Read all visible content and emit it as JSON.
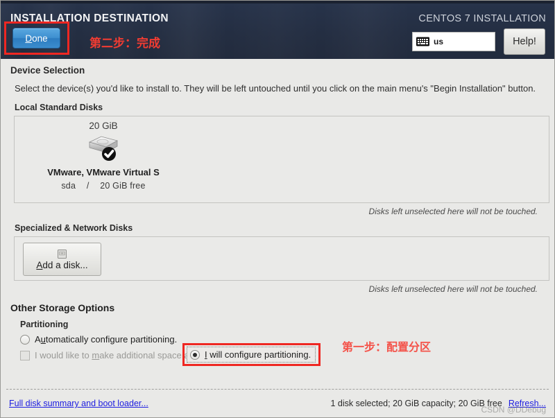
{
  "header": {
    "title": "INSTALLATION DESTINATION",
    "product_title": "CENTOS 7 INSTALLATION",
    "done_label_prefix": "",
    "done_mnemonic": "D",
    "done_label_rest": "one",
    "keyboard_layout": "us",
    "keyboard_icon": "keyboard-icon",
    "help_label": "Help!",
    "annotation": "第二步：完成",
    "accent_blue": "#3e8fd0",
    "annotation_red": "#f23c32",
    "background": "#242e42"
  },
  "device_selection": {
    "title": "Device Selection",
    "description": "Select the device(s) you'd like to install to.  They will be left untouched until you click on the main menu's \"Begin Installation\" button.",
    "local_disks_title": "Local Standard Disks",
    "local_disks": [
      {
        "size": "20 GiB",
        "icon": "hard-disk-selected-icon",
        "name": "VMware, VMware Virtual S",
        "device": "sda",
        "separator": "/",
        "free": "20 GiB free",
        "selected": true
      }
    ],
    "local_hint": "Disks left unselected here will not be touched.",
    "network_disks_title": "Specialized & Network Disks",
    "add_disk_mnemonic": "A",
    "add_disk_label_rest": "dd a disk...",
    "add_disk_icon": "disk-small-icon",
    "network_hint": "Disks left unselected here will not be touched."
  },
  "other_storage": {
    "title": "Other Storage Options",
    "partitioning_title": "Partitioning",
    "options": [
      {
        "id": "auto",
        "mnemonic_pre": "A",
        "mnemonic": "u",
        "rest": "tomatically configure partitioning.",
        "selected": false
      },
      {
        "id": "manual",
        "mnemonic": "I",
        "rest": " will configure partitioning.",
        "selected": true
      }
    ],
    "checkbox": {
      "pre": "I would like to ",
      "mnemonic": "m",
      "rest": "ake additional space available.",
      "checked": false,
      "disabled": true
    },
    "annotation": "第一步：配置分区"
  },
  "footer": {
    "summary_link": "Full disk summary and boot loader...",
    "status": "1 disk selected; 20 GiB capacity; 20 GiB free",
    "refresh_link": "Refresh...",
    "watermark": "CSDN @DDebug"
  }
}
